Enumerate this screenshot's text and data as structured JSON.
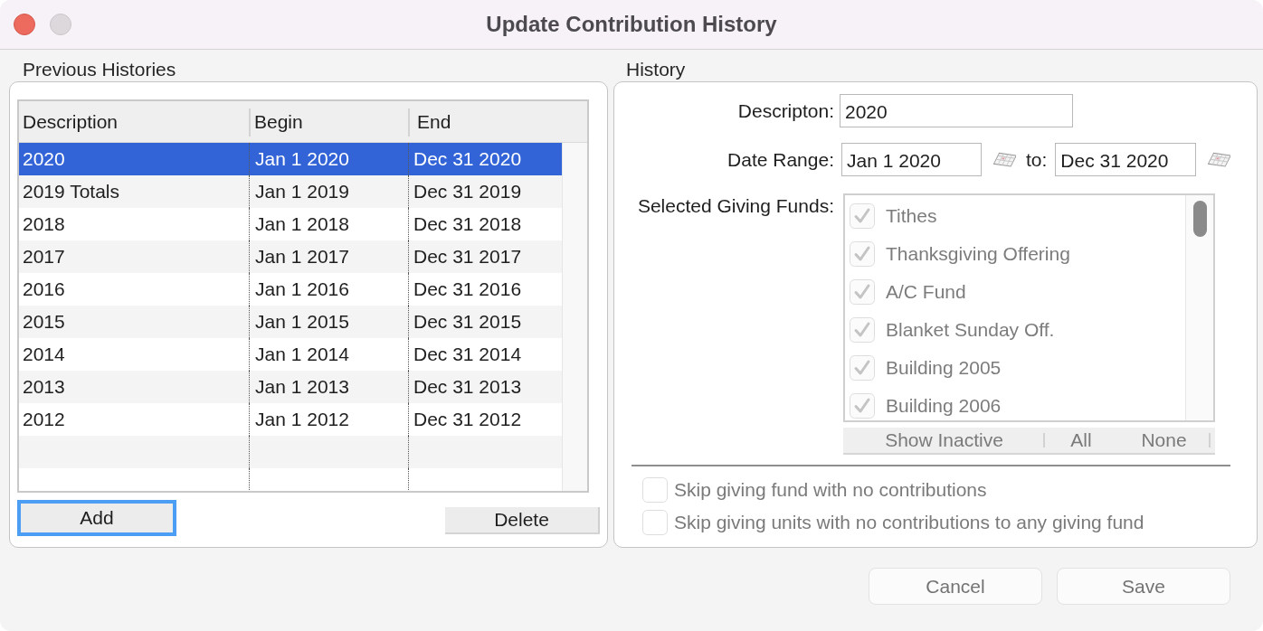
{
  "window": {
    "title": "Update Contribution History"
  },
  "previous_histories": {
    "label": "Previous Histories",
    "table": {
      "columns": [
        "Description",
        "Begin",
        "End"
      ],
      "rows": [
        {
          "cells": [
            "2020",
            "Jan 1 2020",
            "Dec 31 2020"
          ],
          "selected": true
        },
        {
          "cells": [
            "2019 Totals",
            "Jan 1 2019",
            "Dec 31 2019"
          ],
          "selected": false
        },
        {
          "cells": [
            "2018",
            "Jan 1 2018",
            "Dec 31 2018"
          ],
          "selected": false
        },
        {
          "cells": [
            "2017",
            "Jan 1 2017",
            "Dec 31 2017"
          ],
          "selected": false
        },
        {
          "cells": [
            "2016",
            "Jan 1 2016",
            "Dec 31 2016"
          ],
          "selected": false
        },
        {
          "cells": [
            "2015",
            "Jan 1 2015",
            "Dec 31 2015"
          ],
          "selected": false
        },
        {
          "cells": [
            "2014",
            "Jan 1 2014",
            "Dec 31 2014"
          ],
          "selected": false
        },
        {
          "cells": [
            "2013",
            "Jan 1 2013",
            "Dec 31 2013"
          ],
          "selected": false
        },
        {
          "cells": [
            "2012",
            "Jan 1 2012",
            "Dec 31 2012"
          ],
          "selected": false
        }
      ]
    },
    "buttons": [
      {
        "label": "Add",
        "focused": true
      },
      {
        "label": "Delete",
        "focused": false
      }
    ]
  },
  "history": {
    "label": "History",
    "description": {
      "label": "Descripton:",
      "value": "2020"
    },
    "date_range": {
      "label": "Date Range:",
      "from": "Jan 1 2020",
      "separator": "to:",
      "to": "Dec 31 2020"
    },
    "giving_funds": {
      "label": "Selected Giving Funds:",
      "disabled": true,
      "items": [
        {
          "label": "Tithes",
          "checked": true
        },
        {
          "label": "Thanksgiving Offering",
          "checked": true
        },
        {
          "label": "A/C Fund",
          "checked": true
        },
        {
          "label": "Blanket Sunday Off.",
          "checked": true
        },
        {
          "label": "Building 2005",
          "checked": true
        },
        {
          "label": "Building 2006",
          "checked": true
        }
      ],
      "actions": [
        {
          "label": "Show Inactive"
        },
        {
          "label": "All"
        },
        {
          "label": "None"
        }
      ]
    },
    "options": [
      {
        "label": "Skip giving fund with no contributions",
        "checked": false,
        "disabled": true
      },
      {
        "label": "Skip giving units with no contributions to any giving fund",
        "checked": false,
        "disabled": true
      }
    ]
  },
  "footer": {
    "buttons": [
      {
        "label": "Cancel",
        "disabled": true
      },
      {
        "label": "Save",
        "disabled": true
      }
    ]
  }
}
